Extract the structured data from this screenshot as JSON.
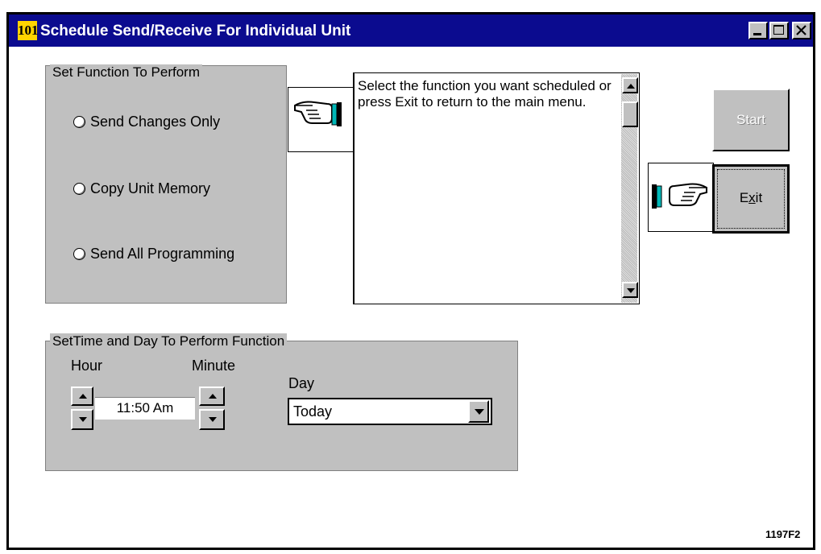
{
  "window": {
    "app_icon_text": "101",
    "title": "Schedule Send/Receive For Individual Unit"
  },
  "function_group": {
    "legend": "Set Function To Perform",
    "options": [
      {
        "label": "Send Changes Only",
        "selected": false
      },
      {
        "label": "Copy Unit Memory",
        "selected": false
      },
      {
        "label": "Send All Programming",
        "selected": false
      }
    ]
  },
  "message": {
    "text": "Select the function you want scheduled or press Exit to return to the main menu."
  },
  "buttons": {
    "start_label": "Start",
    "exit_label_prefix": "E",
    "exit_label_mnemonic": "x",
    "exit_label_suffix": "it"
  },
  "time_group": {
    "legend": "SetTime and Day To Perform Function",
    "hour_label": "Hour",
    "minute_label": "Minute",
    "day_label": "Day",
    "time_value": "11:50 Am",
    "day_value": "Today"
  },
  "figure_code": "1197F2",
  "colors": {
    "title_bar": "#0b0b8f",
    "face": "#c0c0c0"
  }
}
